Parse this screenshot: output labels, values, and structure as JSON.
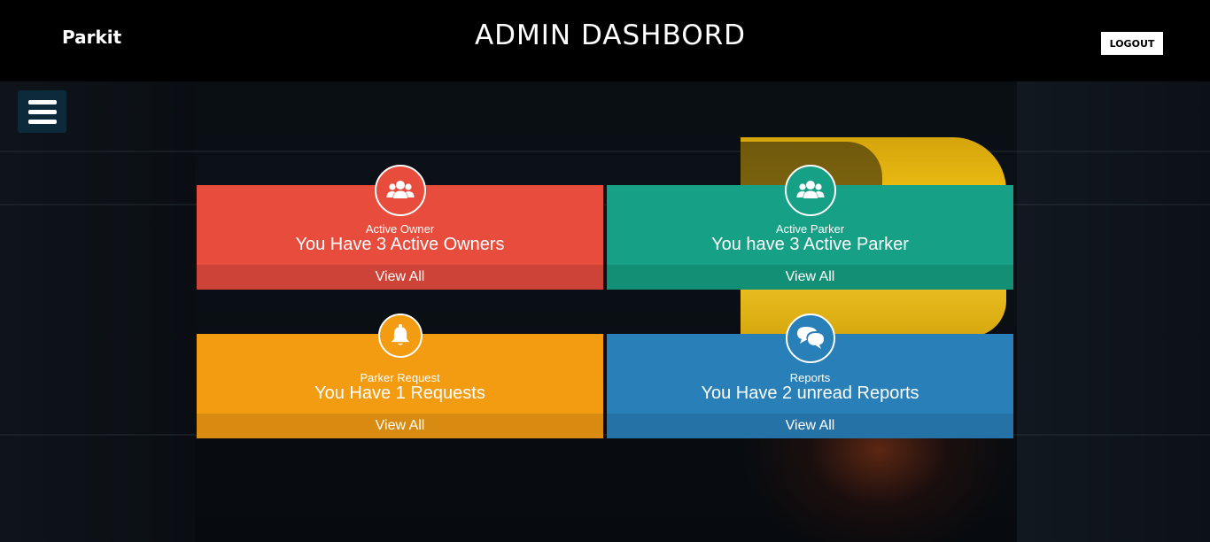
{
  "header": {
    "brand": "Parkit",
    "title": "ADMIN DASHBORD",
    "logout_label": "LOGOUT"
  },
  "menu": {
    "icon": "hamburger-menu-icon"
  },
  "cards": [
    {
      "label": "Active Owner",
      "message": "You Have 3 Active Owners",
      "action": "View All",
      "icon": "users-group-icon",
      "color": "#e74c3c",
      "footer_color": "#ce4338"
    },
    {
      "label": "Active Parker",
      "message": "You have 3 Active Parker",
      "action": "View All",
      "icon": "users-group-icon",
      "color": "#16a085",
      "footer_color": "#138f76"
    },
    {
      "label": "Parker Request",
      "message": "You Have 1 Requests",
      "action": "View All",
      "icon": "bell-icon",
      "color": "#f39c12",
      "footer_color": "#d88b10"
    },
    {
      "label": "Reports",
      "message": "You Have 2 unread Reports",
      "action": "View All",
      "icon": "chat-bubbles-icon",
      "color": "#2980b9",
      "footer_color": "#2472a6"
    }
  ]
}
